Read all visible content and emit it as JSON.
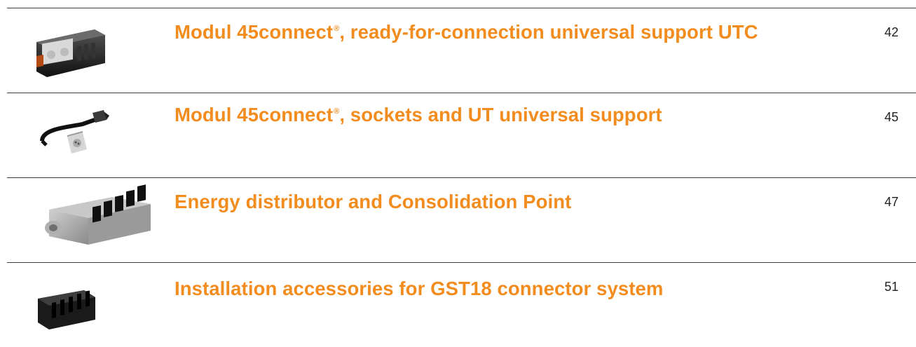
{
  "colors": {
    "accent": "#f28c1e",
    "rule": "#3a3a3a",
    "page_number": "#222222"
  },
  "entries": [
    {
      "title_pre": "Modul 45connect",
      "title_sup": "®",
      "title_post": ", ready-for-connection universal support UTC",
      "page": "42",
      "icon": "utc-support-product-image"
    },
    {
      "title_pre": "Modul 45connect",
      "title_sup": "®",
      "title_post": ", sockets and UT universal support",
      "page": "45",
      "icon": "socket-cable-product-image"
    },
    {
      "title_pre": "Energy distributor and Consolidation Point",
      "title_sup": "",
      "title_post": "",
      "page": "47",
      "icon": "energy-distributor-product-image"
    },
    {
      "title_pre": "Installation accessories for GST18 connector system",
      "title_sup": "",
      "title_post": "",
      "page": "51",
      "icon": "gst18-connector-product-image"
    }
  ]
}
